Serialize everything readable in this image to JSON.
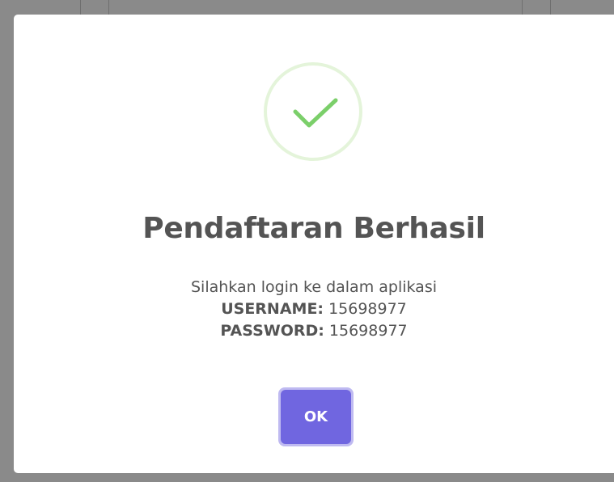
{
  "dialog": {
    "title": "Pendaftaran Berhasil",
    "message": "Silahkan login ke dalam aplikasi",
    "username_label": "USERNAME:",
    "username_value": "15698977",
    "password_label": "PASSWORD:",
    "password_value": "15698977",
    "ok_label": "OK",
    "icon": "success-checkmark-icon"
  },
  "colors": {
    "accent": "#7066e0",
    "success": "#a5dc86",
    "text": "#545454",
    "overlay": "#8a8a8a"
  }
}
